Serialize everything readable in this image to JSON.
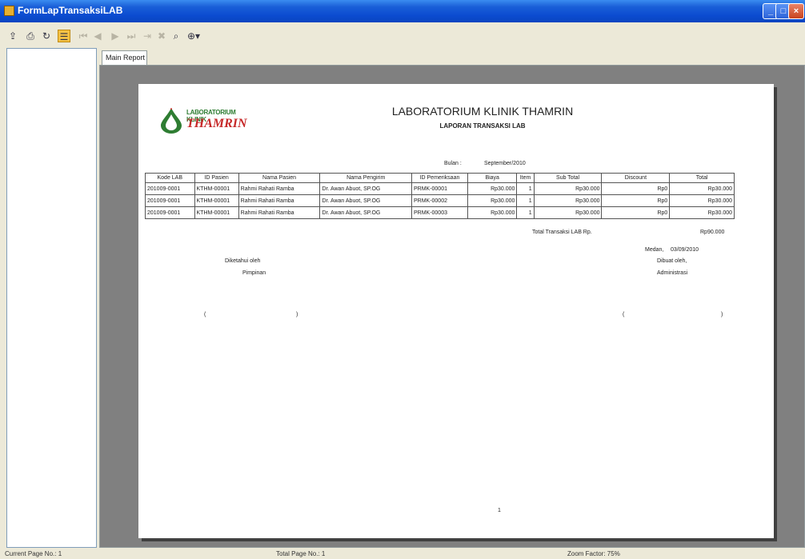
{
  "window": {
    "title": "FormLapTransaksiLAB"
  },
  "toolbar": {
    "icons": [
      "export-icon",
      "print-icon",
      "refresh-icon",
      "group-tree-icon",
      "first-page-icon",
      "prev-page-icon",
      "next-page-icon",
      "last-page-icon",
      "goto-page-icon",
      "close-view-icon",
      "search-icon",
      "zoom-icon"
    ]
  },
  "tab": {
    "label": "Main Report"
  },
  "report": {
    "logo": {
      "top": "LABORATORIUM KLINIK",
      "main": "THAMRIN"
    },
    "title": "LABORATORIUM KLINIK THAMRIN",
    "subtitle": "LAPORAN TRANSAKSI LAB",
    "bulan_label": "Bulan :",
    "bulan_value": "September/2010",
    "columns": [
      "Kode LAB",
      "ID Pasien",
      "Nama Pasien",
      "Nama Pengirim",
      "ID Pemeriksaan",
      "Biaya",
      "Item",
      "Sub Total",
      "Discount",
      "Total"
    ],
    "rows": [
      [
        "201009-0001",
        "KTHM-00001",
        "Rahmi Rahati Ramba",
        "Dr. Awan Abuot, SP.OG",
        "PRMK-00001",
        "Rp30.000",
        "1",
        "Rp30.000",
        "Rp0",
        "Rp30.000"
      ],
      [
        "201009-0001",
        "KTHM-00001",
        "Rahmi Rahati Ramba",
        "Dr. Awan Abuot, SP.OG",
        "PRMK-00002",
        "Rp30.000",
        "1",
        "Rp30.000",
        "Rp0",
        "Rp30.000"
      ],
      [
        "201009-0001",
        "KTHM-00001",
        "Rahmi Rahati Ramba",
        "Dr. Awan Abuot, SP.OG",
        "PRMK-00003",
        "Rp30.000",
        "1",
        "Rp30.000",
        "Rp0",
        "Rp30.000"
      ]
    ],
    "total_label": "Total Transaksi LAB Rp.",
    "total_value": "Rp90.000",
    "city_date_label": "Medan,",
    "date_value": "03/09/2010",
    "left_sign": {
      "title": "Diketahui oleh",
      "role": "Pimpinan",
      "paren_open": "(",
      "paren_close": ")"
    },
    "right_sign": {
      "title": "Dibuat oleh,",
      "role": "Administrasi",
      "paren_open": "(",
      "paren_close": ")"
    },
    "page_number": "1"
  },
  "status": {
    "current_page": "Current Page No.: 1",
    "total_page": "Total Page No.: 1",
    "zoom": "Zoom Factor: 75%"
  },
  "colors": {
    "titlebar": "#0a45c0",
    "viewer_bg": "#808080",
    "logo_green": "#2e7d32",
    "logo_red": "#c62828"
  }
}
